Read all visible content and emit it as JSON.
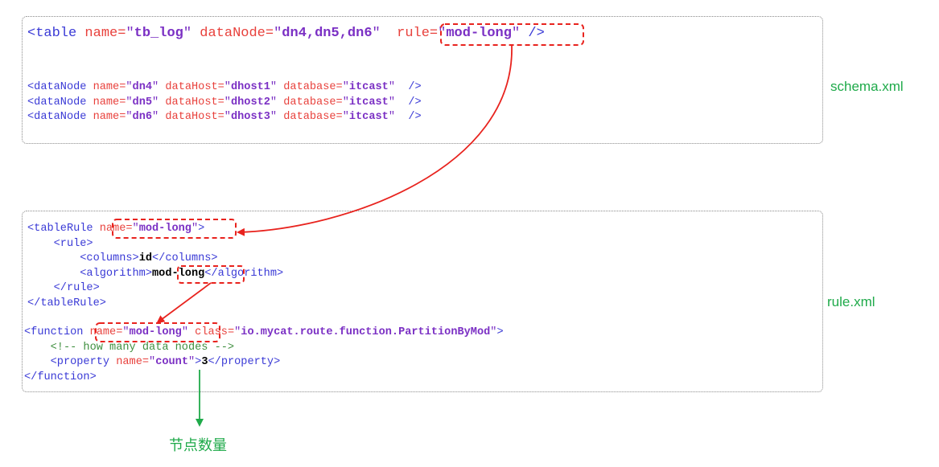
{
  "schema": {
    "file_label": "schema.xml",
    "table_line": {
      "open": "<table ",
      "name_attr": "name=",
      "name_val": "tb_log",
      "datanode_attr": "dataNode=",
      "datanode_val": "dn4,dn5,dn6",
      "rule_attr": "rule=",
      "rule_val": "mod-long",
      "close": "/>"
    },
    "datanodes": [
      {
        "name": "dn4",
        "host": "dhost1",
        "db": "itcast"
      },
      {
        "name": "dn5",
        "host": "dhost2",
        "db": "itcast"
      },
      {
        "name": "dn6",
        "host": "dhost3",
        "db": "itcast"
      }
    ],
    "dn_open": "<dataNode ",
    "dn_name_attr": "name=",
    "dn_host_attr": "dataHost=",
    "dn_db_attr": "database=",
    "dn_close": "/>"
  },
  "rule": {
    "file_label": "rule.xml",
    "tablerule_open": "<tableRule ",
    "tablerule_name_attr": "name=",
    "tablerule_name_val": "mod-long",
    "tablerule_end": ">",
    "rule_open": "<rule>",
    "columns_open": "<columns>",
    "columns_val": "id",
    "columns_close": "</columns>",
    "algorithm_open": "<algorithm>",
    "algorithm_val": "mod-long",
    "algorithm_close": "</algorithm>",
    "rule_close": "</rule>",
    "tablerule_close": "</tableRule>",
    "function_open": "<function ",
    "function_name_attr": "name=",
    "function_name_val": "mod-long",
    "function_class_attr": "class=",
    "function_class_val": "io.mycat.route.function.PartitionByMod",
    "function_end": ">",
    "comment": "<!-- how many data nodes -->",
    "property_open": "<property ",
    "property_name_attr": "name=",
    "property_name_val": "count",
    "property_end": ">",
    "property_val": "3",
    "property_close": "</property>",
    "function_close": "</function>"
  },
  "annotation": {
    "node_count_label": "节点数量"
  },
  "colors": {
    "tag": "#3a3ad6",
    "attribute": "#e8413c",
    "value": "#7b30c4",
    "comment": "#3f8f3f",
    "arrow_red": "#e8231e",
    "arrow_green": "#1faa4a"
  }
}
